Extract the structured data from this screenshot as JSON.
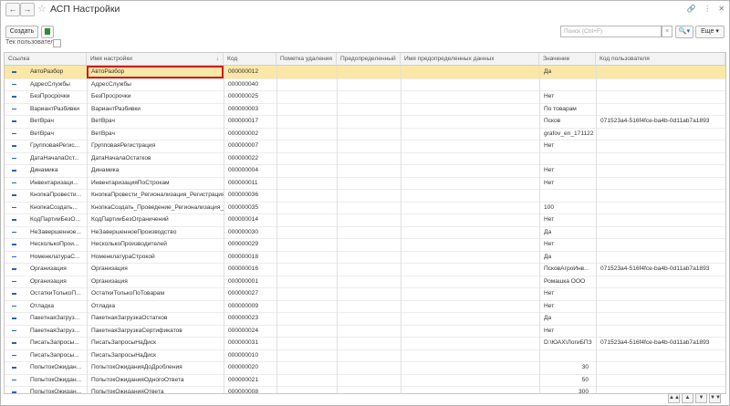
{
  "window": {
    "title": "АСП Настройки"
  },
  "toolbar": {
    "create_label": "Создать",
    "search_placeholder": "Поиск (Ctrl+F)",
    "more_label": "Еще"
  },
  "filter": {
    "current_user_label": "Тек пользователь:"
  },
  "table": {
    "columns": [
      "Ссылка",
      "Имя настройки",
      "Код",
      "Пометка удаления",
      "Предопределенный",
      "Имя предопределенных данных",
      "Значение",
      "Код пользователя"
    ],
    "rows": [
      {
        "ref": "АвтоРазбор",
        "name": "АвтоРазбор",
        "code": "000000012",
        "value": "Да",
        "user": ""
      },
      {
        "ref": "АдресСлужбы",
        "name": "АдресСлужбы",
        "code": "000000040",
        "value": "",
        "user": ""
      },
      {
        "ref": "БезПросрочки",
        "name": "БезПросрочки",
        "code": "000000025",
        "value": "Нет",
        "user": ""
      },
      {
        "ref": "ВариантРазбивки",
        "name": "ВариантРазбивки",
        "code": "000000003",
        "value": "По товарам",
        "user": ""
      },
      {
        "ref": "ВетВрач",
        "name": "ВетВрач",
        "code": "000000017",
        "value": "Псков",
        "user": "071523a4-516f4fce-ba4b-0d11ab7a1893"
      },
      {
        "ref": "ВетВрач",
        "name": "ВетВрач",
        "code": "000000002",
        "value": "grafov_en_171122",
        "user": ""
      },
      {
        "ref": "ГрупповаяРегис...",
        "name": "ГрупповаяРегистрация",
        "code": "000000007",
        "value": "Нет",
        "user": ""
      },
      {
        "ref": "ДатаНачалаОст...",
        "name": "ДатаНачалаОстатков",
        "code": "000000022",
        "value": "",
        "user": ""
      },
      {
        "ref": "Динамика",
        "name": "Динамика",
        "code": "000000004",
        "value": "Нет",
        "user": ""
      },
      {
        "ref": "Инвентаризаци...",
        "name": "ИнвентаризацияПоСтрокам",
        "code": "000000011",
        "value": "Нет",
        "user": ""
      },
      {
        "ref": "КнопкаПровести...",
        "name": "КнопкаПровести_Регионализация_Регистрация",
        "code": "000000036",
        "value": "",
        "user": ""
      },
      {
        "ref": "КнопкаСоздать...",
        "name": "КнопкаСоздать_Проведение_Регионализация_...",
        "code": "000000035",
        "value": "100",
        "user": ""
      },
      {
        "ref": "КодПартииБезО...",
        "name": "КодПартииБезОграничений",
        "code": "000000014",
        "value": "Нет",
        "user": ""
      },
      {
        "ref": "НеЗавершенное...",
        "name": "НеЗавершенноеПроизводство",
        "code": "000000030",
        "value": "Да",
        "user": ""
      },
      {
        "ref": "НесколькоПрои...",
        "name": "НесколькоПроизводителей",
        "code": "000000029",
        "value": "Нет",
        "user": ""
      },
      {
        "ref": "НоменклатураС...",
        "name": "НоменклатураСтрокой",
        "code": "000000018",
        "value": "Да",
        "user": ""
      },
      {
        "ref": "Организация",
        "name": "Организация",
        "code": "000000016",
        "value": "ПсковАгроИнв...",
        "user": "071523a4-516f4fce-ba4b-0d11ab7a1893"
      },
      {
        "ref": "Организация",
        "name": "Организация",
        "code": "000000001",
        "value": "Ромашка ООО",
        "user": ""
      },
      {
        "ref": "ОстаткиТолькоП...",
        "name": "ОстаткиТолькоПоТоварам",
        "code": "000000027",
        "value": "Нет",
        "user": ""
      },
      {
        "ref": "Отладка",
        "name": "Отладка",
        "code": "000000009",
        "value": "Нет",
        "user": ""
      },
      {
        "ref": "ПакетнаяЗагруз...",
        "name": "ПакетнаяЗагрузкаОстатков",
        "code": "000000023",
        "value": "Да",
        "user": ""
      },
      {
        "ref": "ПакетнаяЗагруз...",
        "name": "ПакетнаяЗагрузкаСертификатов",
        "code": "000000024",
        "value": "Нет",
        "user": ""
      },
      {
        "ref": "ПисатьЗапросы...",
        "name": "ПисатьЗапросыНаДиск",
        "code": "000000031",
        "value": "D:\\ЮАХ\\ЛогиБПЗ",
        "user": "071523a4-516f4fce-ba4b-0d11ab7a1893"
      },
      {
        "ref": "ПисатьЗапросы...",
        "name": "ПисатьЗапросыНаДиск",
        "code": "000000010",
        "value": "",
        "user": ""
      },
      {
        "ref": "ПопытокОжидан...",
        "name": "ПопытокОжиданияДоДробления",
        "code": "000000020",
        "value": "30",
        "user": ""
      },
      {
        "ref": "ПопытокОжидан...",
        "name": "ПопытокОжиданияОдногоОтвета",
        "code": "000000021",
        "value": "50",
        "user": ""
      },
      {
        "ref": "ПопытокОжидан...",
        "name": "ПопытокОжиданияОтвета",
        "code": "000000008",
        "value": "300",
        "user": ""
      }
    ]
  }
}
